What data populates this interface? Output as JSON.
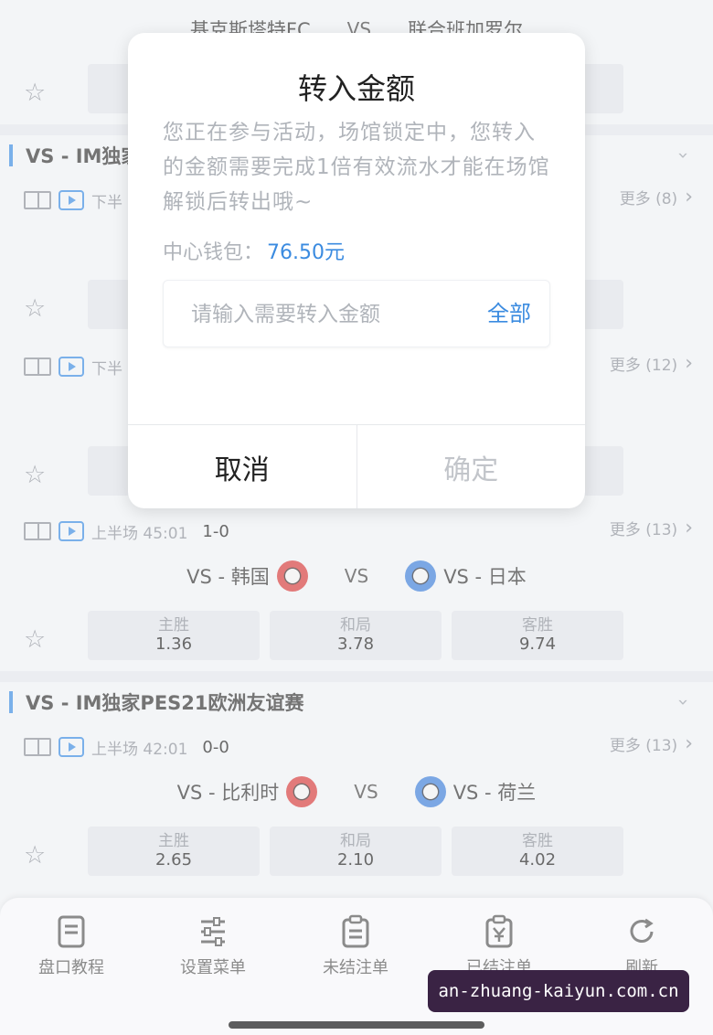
{
  "top_match": {
    "home": "基克斯塔特FC",
    "vs": "VS",
    "away": "联合班加罗尔"
  },
  "league_1": {
    "name": "VS - IM独家"
  },
  "match_1": {
    "status": "下半",
    "more": "更多 (8)"
  },
  "match_2": {
    "status": "下半",
    "more": "更多 (12)"
  },
  "match_3": {
    "status": "上半场 45:01",
    "score": "1-0",
    "more": "更多 (13)",
    "home": "VS - 韩国",
    "vs": "VS",
    "away": "VS - 日本",
    "odds": [
      {
        "label": "主胜",
        "value": "1.36"
      },
      {
        "label": "和局",
        "value": "3.78"
      },
      {
        "label": "客胜",
        "value": "9.74"
      }
    ]
  },
  "league_2": {
    "name": "VS - IM独家PES21欧洲友谊赛"
  },
  "match_4": {
    "status": "上半场 42:01",
    "score": "0-0",
    "more": "更多 (13)",
    "home": "VS - 比利时",
    "vs": "VS",
    "away": "VS - 荷兰",
    "odds": [
      {
        "label": "主胜",
        "value": "2.65"
      },
      {
        "label": "和局",
        "value": "2.10"
      },
      {
        "label": "客胜",
        "value": "4.02"
      }
    ]
  },
  "tabbar": {
    "items": [
      {
        "label": "盘口教程",
        "icon": "document-icon"
      },
      {
        "label": "设置菜单",
        "icon": "sliders-icon"
      },
      {
        "label": "未结注单",
        "icon": "clipboard-icon"
      },
      {
        "label": "已结注单",
        "icon": "settled-clipboard-icon"
      },
      {
        "label": "刷新",
        "icon": "refresh-icon"
      }
    ]
  },
  "watermark": "an-zhuang-kaiyun.com.cn",
  "modal": {
    "title": "转入金额",
    "description": "您正在参与活动，场馆锁定中，您转入的金额需要完成1倍有效流水才能在场馆解锁后转出哦~",
    "wallet_label": "中心钱包：",
    "wallet_amount": "76.50元",
    "input_placeholder": "请输入需要转入金额",
    "all_label": "全部",
    "cancel_label": "取消",
    "confirm_label": "确定"
  },
  "colors": {
    "accent": "#3b8be0",
    "home_badge": "#d43b3b",
    "away_badge": "#3d7ed8"
  }
}
